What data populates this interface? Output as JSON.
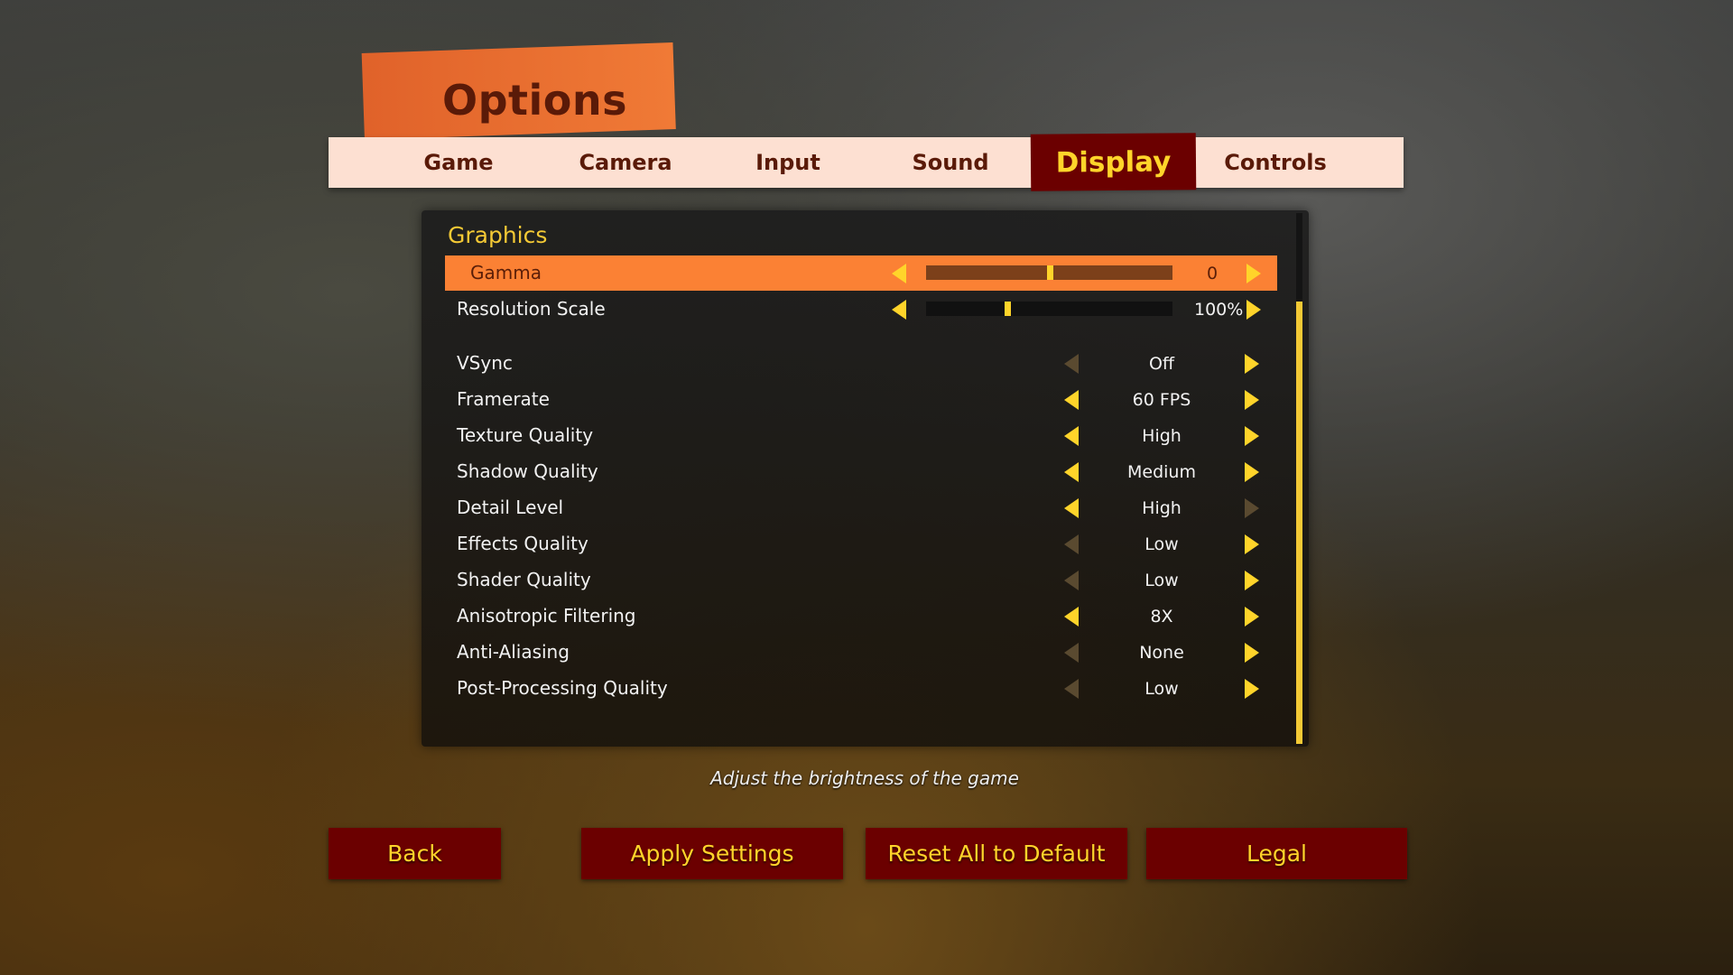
{
  "header": {
    "title": "Options"
  },
  "tabs": [
    {
      "label": "Game"
    },
    {
      "label": "Camera"
    },
    {
      "label": "Input"
    },
    {
      "label": "Sound"
    },
    {
      "label": "Display",
      "active": true
    },
    {
      "label": "Controls"
    }
  ],
  "section": "Graphics",
  "settings": [
    {
      "label": "Gamma",
      "type": "slider",
      "value": "0",
      "fill": 0.5,
      "highlighted": true,
      "left_enabled": true,
      "right_enabled": true
    },
    {
      "label": "Resolution Scale",
      "type": "slider",
      "value": "100%",
      "fill": 0.33,
      "left_enabled": true,
      "right_enabled": true
    },
    {
      "label": "VSync",
      "type": "select",
      "value": "Off",
      "left_enabled": false,
      "right_enabled": true
    },
    {
      "label": "Framerate",
      "type": "select",
      "value": "60 FPS",
      "left_enabled": true,
      "right_enabled": true
    },
    {
      "label": "Texture Quality",
      "type": "select",
      "value": "High",
      "left_enabled": true,
      "right_enabled": true
    },
    {
      "label": "Shadow Quality",
      "type": "select",
      "value": "Medium",
      "left_enabled": true,
      "right_enabled": true
    },
    {
      "label": "Detail Level",
      "type": "select",
      "value": "High",
      "left_enabled": true,
      "right_enabled": false
    },
    {
      "label": "Effects Quality",
      "type": "select",
      "value": "Low",
      "left_enabled": false,
      "right_enabled": true
    },
    {
      "label": "Shader Quality",
      "type": "select",
      "value": "Low",
      "left_enabled": false,
      "right_enabled": true
    },
    {
      "label": "Anisotropic Filtering",
      "type": "select",
      "value": "8X",
      "left_enabled": true,
      "right_enabled": true
    },
    {
      "label": "Anti-Aliasing",
      "type": "select",
      "value": "None",
      "left_enabled": false,
      "right_enabled": true
    },
    {
      "label": "Post-Processing Quality",
      "type": "select",
      "value": "Low",
      "left_enabled": false,
      "right_enabled": true
    }
  ],
  "description": "Adjust the brightness of the game",
  "buttons": {
    "back": "Back",
    "apply": "Apply Settings",
    "reset": "Reset All to Default",
    "legal": "Legal"
  },
  "colors": {
    "accent": "#ffd42a",
    "highlight": "#fb8134",
    "button": "#6b0000",
    "tab_bar": "#fde0d2"
  }
}
